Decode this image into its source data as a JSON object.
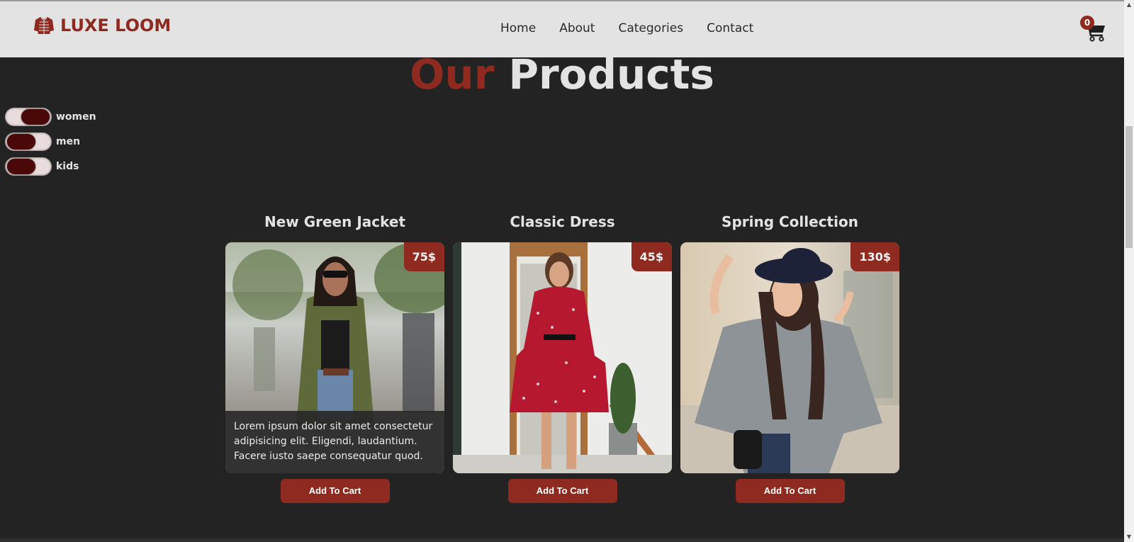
{
  "brand": {
    "name": "LUXE LOOM",
    "icon": "sweater-icon",
    "color": "#8e2a1f"
  },
  "nav": {
    "links": [
      "Home",
      "About",
      "Categories",
      "Contact"
    ]
  },
  "cart": {
    "count": "0",
    "icon": "cart-icon"
  },
  "heading": {
    "word1": "Our",
    "word2": "Products"
  },
  "filters": [
    {
      "label": "women",
      "on": true
    },
    {
      "label": "men",
      "on": false
    },
    {
      "label": "kids",
      "on": false
    }
  ],
  "products": [
    {
      "title": "New Green Jacket",
      "price": "75$",
      "description": "Lorem ipsum dolor sit amet consectetur adipisicing elit. Eligendi, laudantium. Facere iusto saepe consequatur quod.",
      "button": "Add To Cart"
    },
    {
      "title": "Classic Dress",
      "price": "45$",
      "description": "",
      "button": "Add To Cart"
    },
    {
      "title": "Spring Collection",
      "price": "130$",
      "description": "",
      "button": "Add To Cart"
    }
  ],
  "colors": {
    "background": "#232323",
    "navbar": "#e3e3e3",
    "accent": "#8e2a1f",
    "toggle_knob": "#4b0808"
  }
}
